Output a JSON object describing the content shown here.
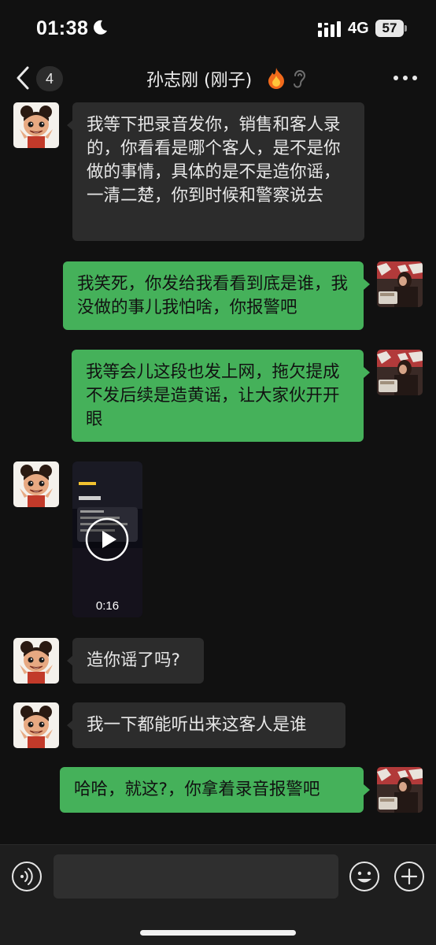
{
  "status_bar": {
    "time": "01:38",
    "network": "4G",
    "battery": "57"
  },
  "nav": {
    "unread_count": "4",
    "title": "孙志刚 (刚子)"
  },
  "messages": [
    {
      "side": "in",
      "text": "我等下把录音发你，销售和客人录的，你看看是哪个客人，是不是你做的事情，具体的是不是造你谣，一清二楚，你到时候和警察说去"
    },
    {
      "side": "out",
      "text": "我笑死，你发给我看看到底是谁，我没做的事儿我怕啥，你报警吧"
    },
    {
      "side": "out",
      "text": "我等会儿这段也发上网，拖欠提成不发后续是造黄谣，让大家伙开开眼"
    },
    {
      "side": "in",
      "type": "video",
      "duration": "0:16"
    },
    {
      "side": "in",
      "text": "造你谣了吗?"
    },
    {
      "side": "in",
      "text": "我一下都能听出来这客人是谁"
    },
    {
      "side": "out",
      "text": "哈哈，就这?，你拿着录音报警吧"
    }
  ],
  "colors": {
    "background": "#111111",
    "incoming_bubble": "#2c2c2c",
    "outgoing_bubble": "#45b15a",
    "input_bar": "#1e1e1e"
  },
  "icons": {
    "status": [
      "moon-icon",
      "signal-icon",
      "battery-icon"
    ],
    "nav": [
      "back-chevron-icon",
      "fire-icon",
      "ear-icon",
      "more-icon"
    ],
    "input": [
      "voice-icon",
      "emoji-icon",
      "plus-icon"
    ]
  }
}
